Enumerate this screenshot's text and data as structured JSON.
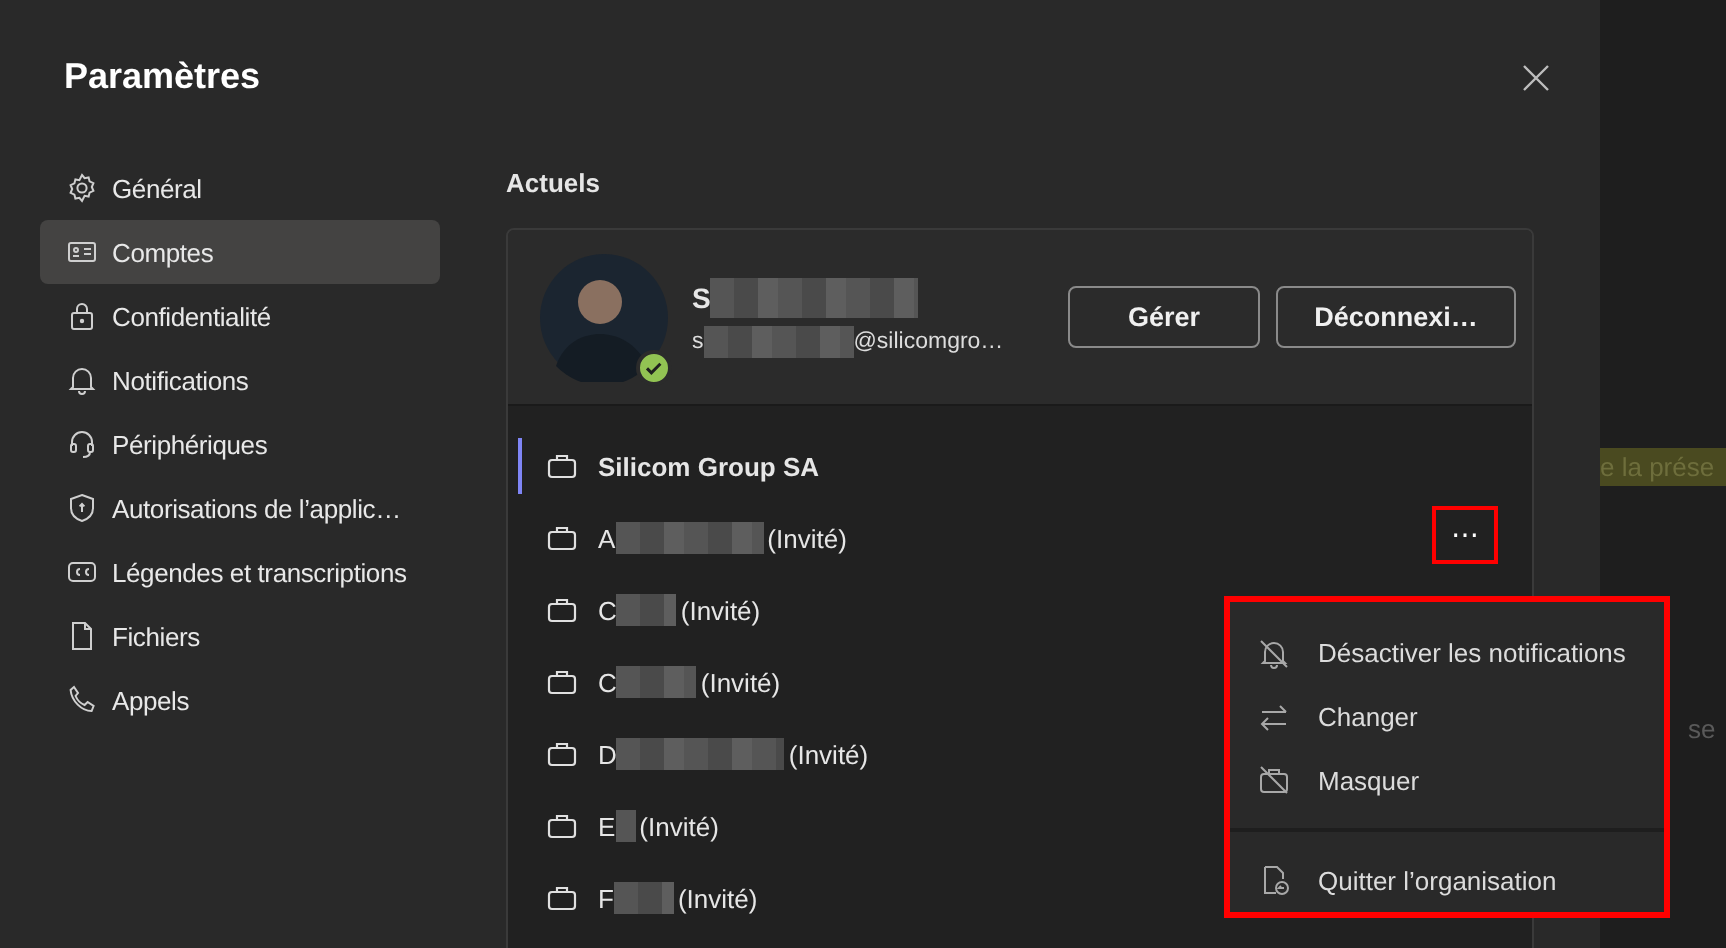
{
  "dialog": {
    "title": "Paramètres"
  },
  "sidebar": {
    "items": [
      {
        "label": "Général",
        "selected": false
      },
      {
        "label": "Comptes",
        "selected": true
      },
      {
        "label": "Confidentialité",
        "selected": false
      },
      {
        "label": "Notifications",
        "selected": false
      },
      {
        "label": "Périphériques",
        "selected": false
      },
      {
        "label": "Autorisations de l’applic…",
        "selected": false
      },
      {
        "label": "Légendes et transcriptions",
        "selected": false
      },
      {
        "label": "Fichiers",
        "selected": false
      },
      {
        "label": "Appels",
        "selected": false
      }
    ]
  },
  "section_title": "Actuels",
  "account": {
    "name_start": "S",
    "email_start": "s",
    "email_end": "@silicomgro…",
    "buttons": [
      "Gérer",
      "Déconnexi…"
    ]
  },
  "organizations": [
    {
      "start": "Silicom Group SA",
      "redacted": false,
      "selected": true,
      "more": false
    },
    {
      "start": "A",
      "redacted": true,
      "suffix": "(Invité)",
      "selected": false,
      "more": true
    },
    {
      "start": "C",
      "redacted": true,
      "suffix": "(Invité)",
      "selected": false,
      "more": false
    },
    {
      "start": "C",
      "redacted": true,
      "suffix": "(Invité)",
      "selected": false,
      "more": false
    },
    {
      "start": "D",
      "redacted": true,
      "suffix": "(Invité)",
      "selected": false,
      "more": false
    },
    {
      "start": "E",
      "redacted": true,
      "suffix": "(Invité)",
      "selected": false,
      "more": false
    },
    {
      "start": "F",
      "redacted": true,
      "suffix": "(Invité)",
      "selected": false,
      "more": false
    }
  ],
  "more_button": "⋯",
  "context_menu": {
    "items": [
      {
        "label": "Désactiver les notifications",
        "divider_before": false
      },
      {
        "label": "Changer",
        "divider_before": false
      },
      {
        "label": "Masquer",
        "divider_before": false
      },
      {
        "label": "Quitter l’organisation",
        "divider_before": true
      }
    ]
  },
  "background_texts": [
    "e la prése",
    "se"
  ]
}
